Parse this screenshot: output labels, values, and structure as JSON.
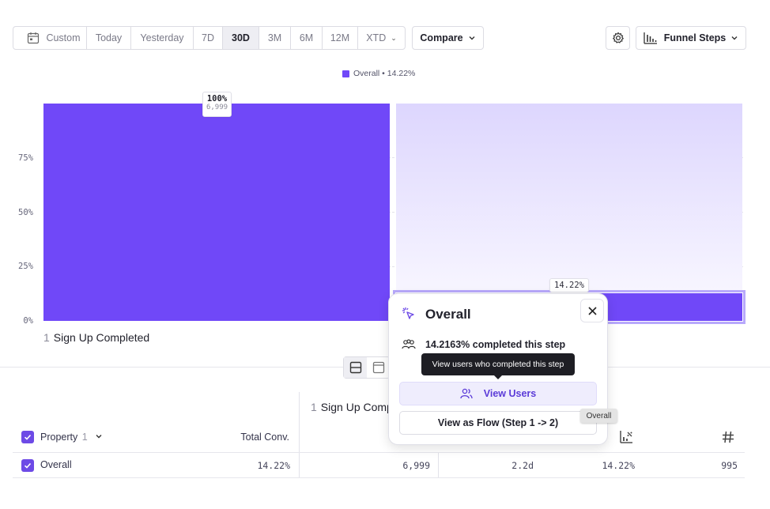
{
  "toolbar": {
    "date_options": [
      {
        "label": "Custom",
        "active": false
      },
      {
        "label": "Today",
        "active": false
      },
      {
        "label": "Yesterday",
        "active": false
      },
      {
        "label": "7D",
        "active": false
      },
      {
        "label": "30D",
        "active": true
      },
      {
        "label": "3M",
        "active": false
      },
      {
        "label": "6M",
        "active": false
      },
      {
        "label": "12M",
        "active": false
      },
      {
        "label": "XTD",
        "active": false
      }
    ],
    "compare_label": "Compare",
    "chart_type_label": "Funnel Steps",
    "icons": {
      "calendar": "calendar-icon",
      "settings": "gear-icon",
      "chart_type": "bar-chart-icon"
    }
  },
  "chart": {
    "legend": "Overall • 14.22%",
    "colors": {
      "bar": "#7048f8",
      "bar_light": "#ddd6fe",
      "selected_border": "#b8a9fb"
    }
  },
  "chart_data": {
    "type": "bar",
    "categories": [
      "Sign Up Completed",
      ""
    ],
    "series": [
      {
        "name": "Overall",
        "values": [
          100,
          14.22
        ]
      }
    ],
    "data_labels": [
      [
        "100%",
        "6,999"
      ],
      [
        "14.22%"
      ]
    ],
    "yticks": [
      "0%",
      "25%",
      "50%",
      "75%"
    ],
    "ylim": [
      0,
      100
    ],
    "legend_position": "top-center"
  },
  "step_label": {
    "num": "1",
    "name": "Sign Up Completed"
  },
  "table": {
    "header": {
      "property": "Property",
      "property_count": "1",
      "total_conv": "Total Conv.",
      "step_num": "1",
      "step_name": "Sign Up Comp"
    },
    "row": {
      "name": "Overall",
      "total_conv": "14.22%",
      "step_count": "6,999",
      "time": "2.2d",
      "conv": "14.22%",
      "count": "995"
    }
  },
  "popover": {
    "title": "Overall",
    "stat": "14.2163% completed this step",
    "tooltip": "View users who completed this step",
    "view_users": "View Users",
    "view_flow": "View as Flow (Step 1 -> 2)"
  },
  "mini_tooltip": "Overall"
}
